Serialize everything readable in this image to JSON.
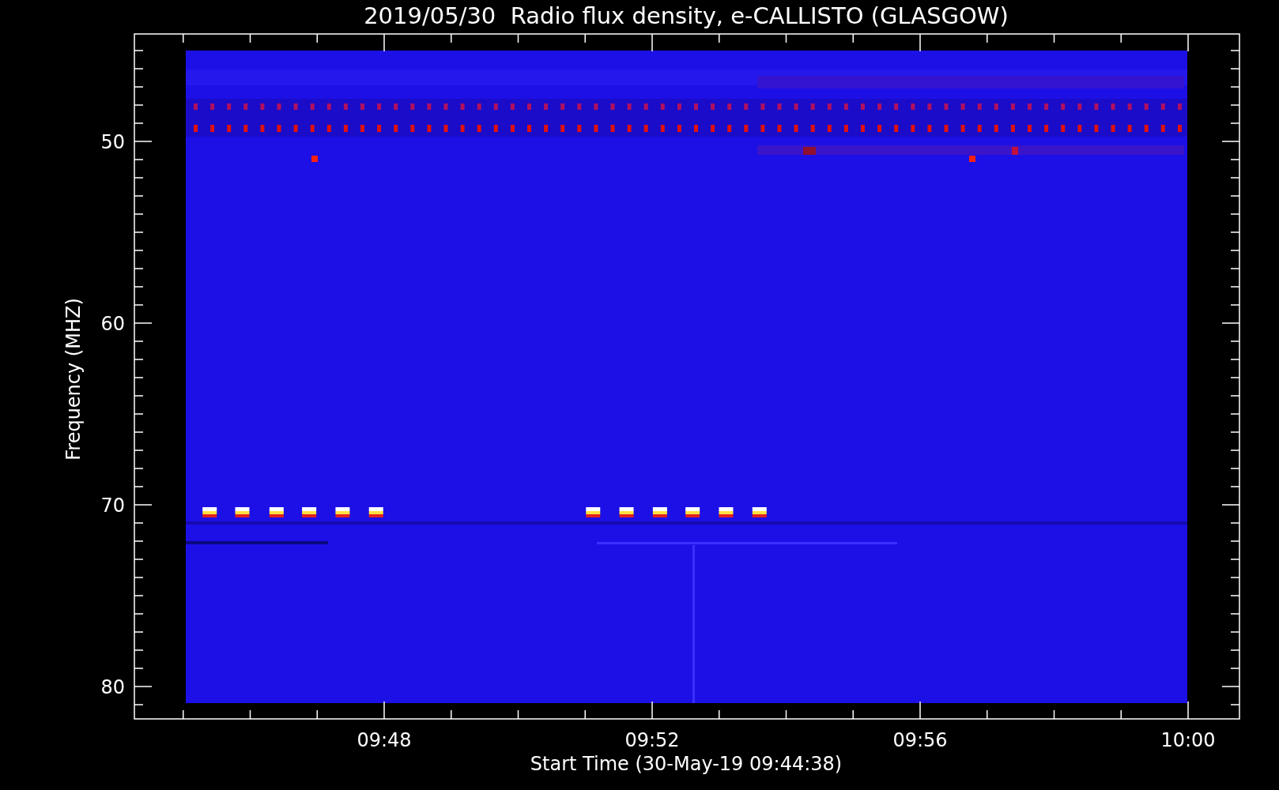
{
  "plot": {
    "title": "2019/05/30  Radio flux density, e-CALLISTO (GLASGOW)",
    "ylabel": "Frequency (MHZ)",
    "xlabel": "Start Time (30-May-19 09:44:38)",
    "y_tick_labels": [
      "50",
      "60",
      "70",
      "80"
    ],
    "x_tick_labels": [
      "09:48",
      "09:52",
      "09:56",
      "10:00"
    ]
  }
}
